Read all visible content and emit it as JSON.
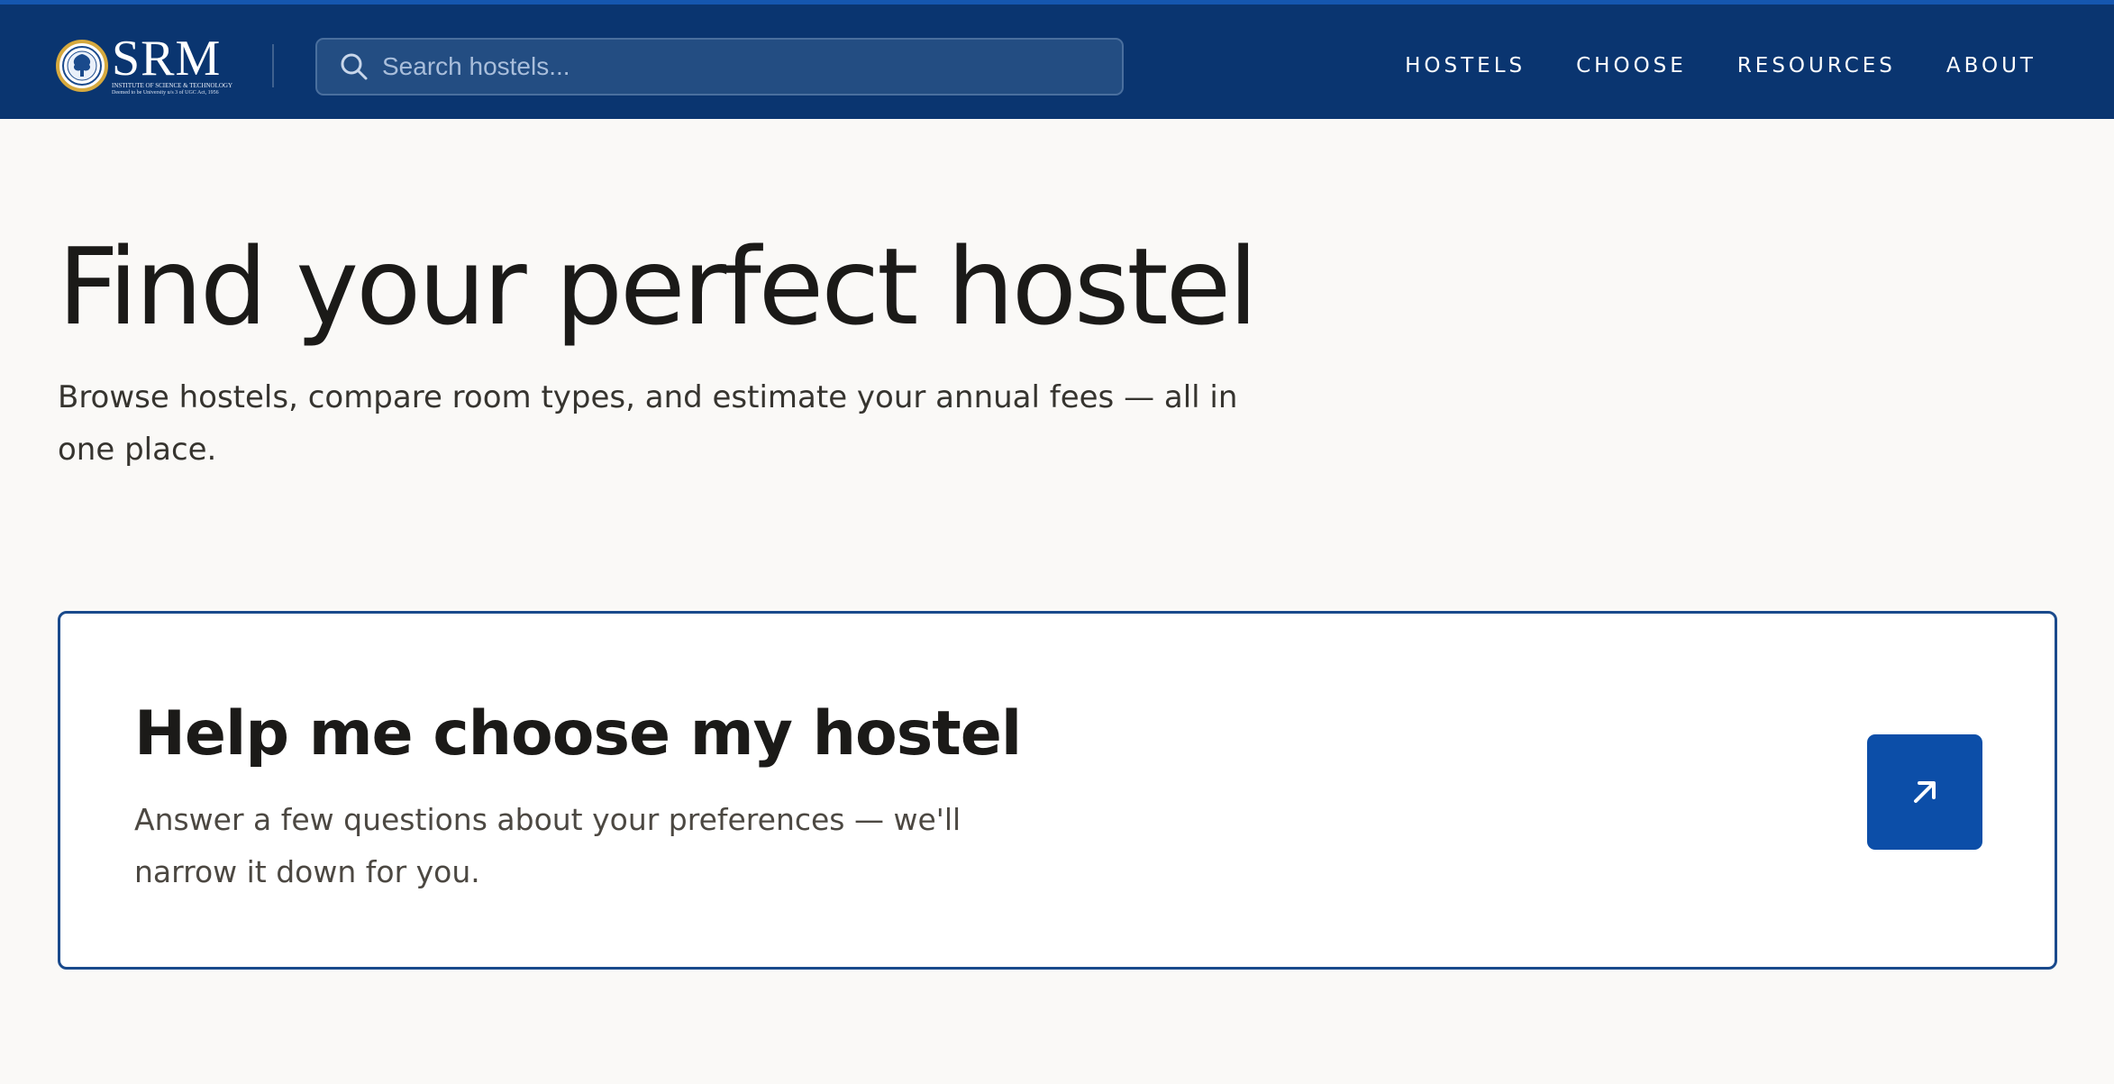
{
  "header": {
    "logo": {
      "wordmark": "SRM",
      "subtitle": "INSTITUTE OF SCIENCE & TECHNOLOGY",
      "tagline": "Deemed to be University u/s 3 of UGC Act, 1956"
    },
    "search": {
      "placeholder": "Search hostels..."
    },
    "nav": [
      {
        "label": "HOSTELS"
      },
      {
        "label": "CHOOSE"
      },
      {
        "label": "RESOURCES"
      },
      {
        "label": "ABOUT"
      }
    ]
  },
  "hero": {
    "title": "Find your perfect hostel",
    "subtitle": "Browse hostels, compare room types, and estimate your annual fees — all in one place."
  },
  "card": {
    "title": "Help me choose my hostel",
    "subtitle": "Answer a few questions about your preferences — we'll narrow it down for you.",
    "button_icon": "arrow-up-right-icon"
  },
  "colors": {
    "header_bg": "#0a3570",
    "header_accent": "#1557b0",
    "page_bg": "#faf9f7",
    "card_border": "#1a4a8c",
    "button_bg": "#0c4ea8",
    "text_dark": "#1b1a18"
  }
}
